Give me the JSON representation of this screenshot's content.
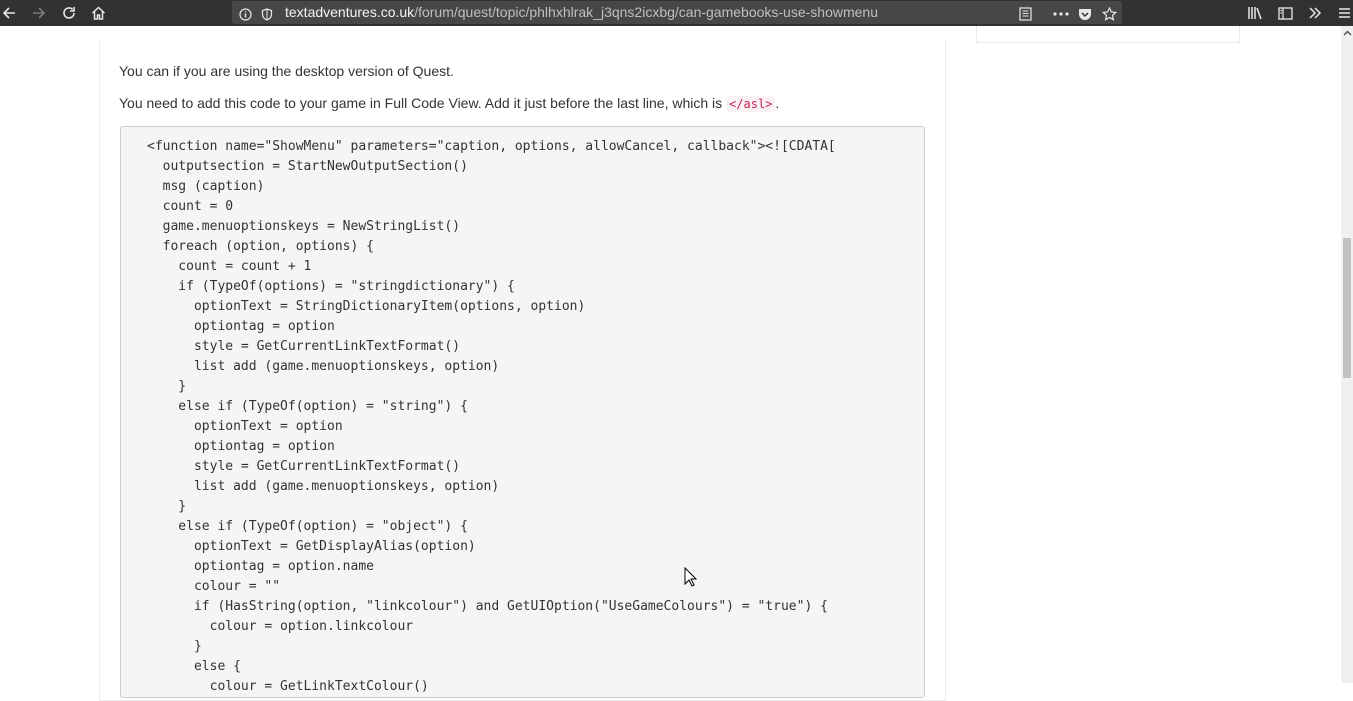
{
  "browser": {
    "url_host": "textadventures.co.uk",
    "url_path": "/forum/quest/topic/phlhxhlrak_j3qns2icxbg/can-gamebooks-use-showmenu",
    "icons": [
      "back-arrow-icon",
      "forward-arrow-icon",
      "reload-icon",
      "home-icon",
      "info-icon",
      "shield-icon",
      "reader-view-icon",
      "more-actions-icon",
      "pocket-icon",
      "bookmark-star-icon",
      "library-icon",
      "sidebar-icon",
      "overflow-chevrons-icon",
      "hamburger-menu-icon"
    ]
  },
  "post": {
    "paragraph1": "You can if you are using the desktop version of Quest.",
    "paragraph2_before": "You need to add this code to your game in Full Code View. Add it just before the last line, which is ",
    "paragraph2_code": "</asl>",
    "paragraph2_after": ".",
    "code_lines": [
      "<function name=\"ShowMenu\" parameters=\"caption, options, allowCancel, callback\"><![CDATA[",
      "  outputsection = StartNewOutputSection()",
      "  msg (caption)",
      "  count = 0",
      "  game.menuoptionskeys = NewStringList()",
      "  foreach (option, options) {",
      "    count = count + 1",
      "    if (TypeOf(options) = \"stringdictionary\") {",
      "      optionText = StringDictionaryItem(options, option)",
      "      optiontag = option",
      "      style = GetCurrentLinkTextFormat()",
      "      list add (game.menuoptionskeys, option)",
      "    }",
      "    else if (TypeOf(option) = \"string\") {",
      "      optionText = option",
      "      optiontag = option",
      "      style = GetCurrentLinkTextFormat()",
      "      list add (game.menuoptionskeys, option)",
      "    }",
      "    else if (TypeOf(option) = \"object\") {",
      "      optionText = GetDisplayAlias(option)",
      "      optiontag = option.name",
      "      colour = \"\"",
      "      if (HasString(option, \"linkcolour\") and GetUIOption(\"UseGameColours\") = \"true\") {",
      "        colour = option.linkcolour",
      "      }",
      "      else {",
      "        colour = GetLinkTextColour()"
    ]
  }
}
